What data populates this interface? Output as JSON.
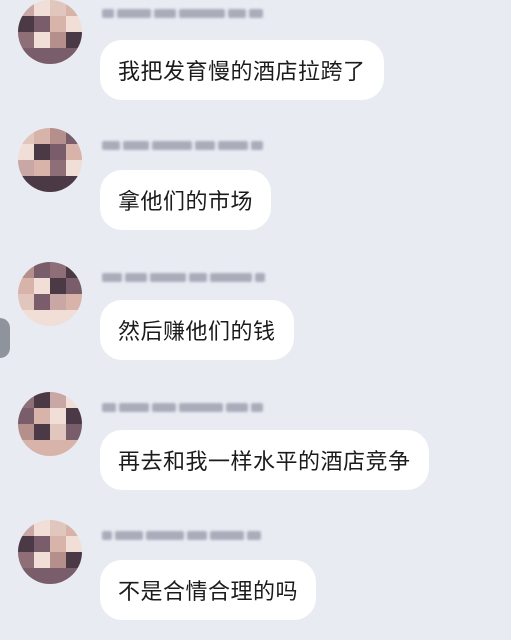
{
  "messages": [
    {
      "sender": "",
      "text": "我把发育慢的酒店拉跨了"
    },
    {
      "sender": "",
      "text": "拿他们的市场"
    },
    {
      "sender": "",
      "text": "然后赚他们的钱"
    },
    {
      "sender": "",
      "text": "再去和我一样水平的酒店竞争"
    },
    {
      "sender": "",
      "text": "不是合情合理的吗"
    }
  ],
  "colors": {
    "background": "#e9ebf3",
    "bubble": "#ffffff",
    "text": "#1b1b1b",
    "avatar_pixels": [
      "#c9a7a4",
      "#7a5d6a",
      "#e1c6bd",
      "#4b3a46",
      "#b58f8b",
      "#f1dfd7",
      "#8f6f77",
      "#d8b3aa"
    ]
  }
}
